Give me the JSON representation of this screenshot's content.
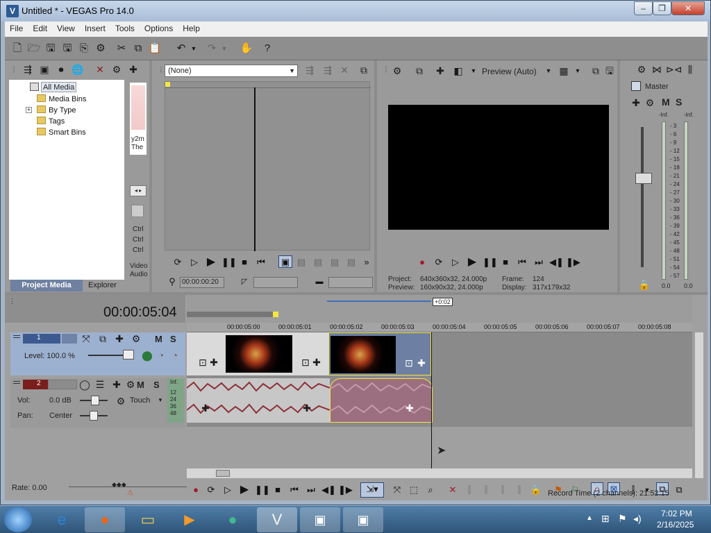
{
  "window": {
    "title": "Untitled * - VEGAS Pro 14.0",
    "app_icon": "vegas-icon"
  },
  "menu": [
    "File",
    "Edit",
    "View",
    "Insert",
    "Tools",
    "Options",
    "Help"
  ],
  "explorer": {
    "tree": [
      "All Media",
      "Media Bins",
      "By Type",
      "Tags",
      "Smart Bins"
    ],
    "expander": "+",
    "tabs": [
      "Project Media",
      "Explorer"
    ],
    "thumb_caption": [
      "y2m",
      "The"
    ],
    "side_labels": [
      "Ctrl",
      "Ctrl",
      "Ctrl",
      "Video",
      "Audio"
    ]
  },
  "trimmer": {
    "dropdown": "(None)",
    "timecode": "00:00:00:20"
  },
  "preview": {
    "mode": "Preview (Auto)",
    "project_label": "Project:",
    "project_value": "640x360x32, 24.000p",
    "preview_label": "Preview:",
    "preview_value": "160x90x32, 24.000p",
    "frame_label": "Frame:",
    "frame_value": "124",
    "display_label": "Display:",
    "display_value": "317x179x32"
  },
  "master": {
    "title": "Master",
    "m": "M",
    "s": "S",
    "inf_left": "-Inf.",
    "inf_right": "-Inf.",
    "scale": [
      "3",
      "6",
      "9",
      "12",
      "15",
      "18",
      "21",
      "24",
      "27",
      "30",
      "33",
      "36",
      "39",
      "42",
      "45",
      "48",
      "51",
      "54",
      "57"
    ],
    "bottom_left": "0.0",
    "bottom_right": "0.0"
  },
  "timeline": {
    "timecode": "00:00:05:04",
    "offset_badge": "+0:02",
    "ruler": [
      "00:00:05:00",
      "00:00:05:01",
      "00:00:05:02",
      "00:00:05:03",
      "00:00:05:04",
      "00:00:05:05",
      "00:00:05:06",
      "00:00:05:07",
      "00:00:05:08"
    ],
    "video_track": {
      "number": "1",
      "level_label": "Level: 100.0 %",
      "m": "M",
      "s": "S"
    },
    "audio_track": {
      "number": "2",
      "vol_label": "Vol:",
      "vol_value": "0.0 dB",
      "pan_label": "Pan:",
      "pan_value": "Center",
      "mode": "Touch",
      "m": "M",
      "s": "S",
      "meter_labels": [
        "Inf.",
        "12",
        "24",
        "36",
        "48"
      ]
    },
    "rate": "Rate: 0.00",
    "record_time": "Record Time (2 channels): 21:52:15"
  },
  "taskbar": {
    "time": "7:02 PM",
    "date": "2/16/2025"
  },
  "colors": {
    "accent": "#6f80a1",
    "selection": "#f5e642",
    "video_track": "#9cb0cf"
  }
}
